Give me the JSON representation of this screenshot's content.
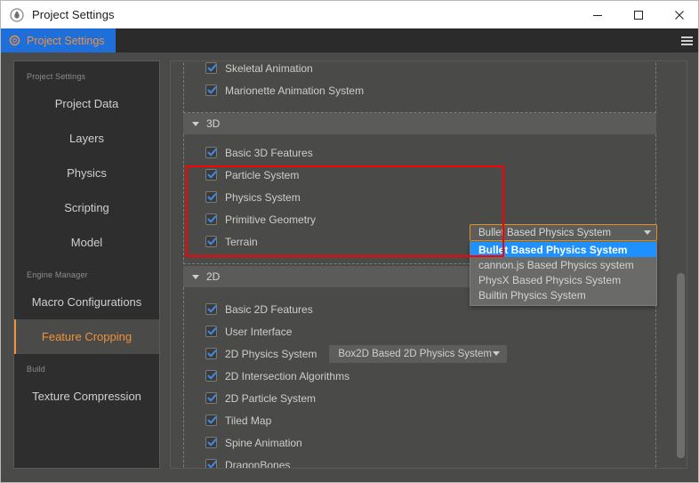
{
  "window": {
    "title": "Project Settings",
    "title_icon": "cocos-logo-icon",
    "controls": {
      "minimize": "minimize-icon",
      "maximize": "maximize-icon",
      "close": "close-icon"
    }
  },
  "tabbar": {
    "tab_label": "Project Settings",
    "tab_icon": "gear-icon",
    "menu_icon": "hamburger-menu-icon",
    "active_tab_bg": "#1e6fd9",
    "active_tab_text": "#f0913b"
  },
  "sidebar": {
    "sections": [
      {
        "label": "Project Settings",
        "items": [
          {
            "label": "Project Data",
            "active": false
          },
          {
            "label": "Layers",
            "active": false
          },
          {
            "label": "Physics",
            "active": false
          },
          {
            "label": "Scripting",
            "active": false
          },
          {
            "label": "Model",
            "active": false
          }
        ]
      },
      {
        "label": "Engine Manager",
        "items": [
          {
            "label": "Macro Configurations",
            "active": false
          },
          {
            "label": "Feature Cropping",
            "active": true
          }
        ]
      },
      {
        "label": "Build",
        "items": [
          {
            "label": "Texture Compression",
            "active": false
          }
        ]
      }
    ],
    "active_color": "#f0913b"
  },
  "main": {
    "top_partial_group": {
      "rows": [
        {
          "label": "Skeletal Animation",
          "checked": true
        },
        {
          "label": "Marionette Animation System",
          "checked": true
        }
      ]
    },
    "groups": [
      {
        "title": "3D",
        "expanded": true,
        "rows": [
          {
            "label": "Basic 3D Features",
            "checked": true,
            "select": null
          },
          {
            "label": "Particle System",
            "checked": true,
            "select": null
          },
          {
            "label": "Physics System",
            "checked": true,
            "select": "open_combo"
          },
          {
            "label": "Primitive Geometry",
            "checked": true,
            "select": null
          },
          {
            "label": "Terrain",
            "checked": true,
            "select": null
          }
        ]
      },
      {
        "title": "2D",
        "expanded": true,
        "rows": [
          {
            "label": "Basic 2D Features",
            "checked": true,
            "select": null
          },
          {
            "label": "User Interface",
            "checked": true,
            "select": null
          },
          {
            "label": "2D Physics System",
            "checked": true,
            "select": "Box2D Based 2D Physics System"
          },
          {
            "label": "2D Intersection Algorithms",
            "checked": true,
            "select": null
          },
          {
            "label": "2D Particle System",
            "checked": true,
            "select": null
          },
          {
            "label": "Tiled Map",
            "checked": true,
            "select": null
          },
          {
            "label": "Spine Animation",
            "checked": true,
            "select": null
          },
          {
            "label": "DragonBones",
            "checked": true,
            "select": null
          }
        ]
      }
    ],
    "physics_combo": {
      "value": "Bullet Based Physics System",
      "expanded": true,
      "options": [
        {
          "label": "Bullet Based Physics System",
          "selected": true
        },
        {
          "label": "cannon.js Based Physics system",
          "selected": false
        },
        {
          "label": "PhysX Based Physics System",
          "selected": false
        },
        {
          "label": "Builtin Physics System",
          "selected": false
        }
      ],
      "highlight_color": "#1e90ff",
      "focus_border_color": "#e0921f"
    },
    "annotation": {
      "type": "red-highlight-rectangle",
      "color": "#ff0000"
    }
  }
}
